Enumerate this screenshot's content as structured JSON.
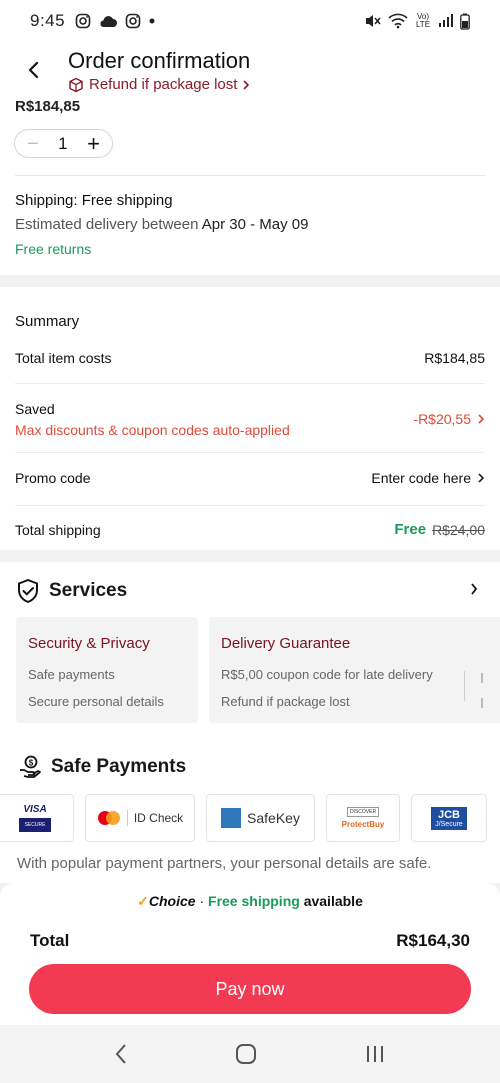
{
  "status_bar": {
    "time": "9:45",
    "network": "Vo) LTE"
  },
  "header": {
    "title": "Order confirmation",
    "refund_link": "Refund if package lost"
  },
  "product": {
    "price": "R$184,85",
    "quantity": "1",
    "minus": "−",
    "plus": "+"
  },
  "shipping": {
    "method_label": "Shipping: Free shipping",
    "estimate_prefix": "Estimated delivery between",
    "estimate_dates": "Apr 30 - May 09",
    "returns": "Free returns"
  },
  "summary": {
    "title": "Summary",
    "total_item_costs_label": "Total item costs",
    "total_item_costs_value": "R$184,85",
    "saved_label": "Saved",
    "saved_value": "-R$20,55",
    "saved_note": "Max discounts & coupon codes auto-applied",
    "promo_label": "Promo code",
    "promo_action": "Enter code here",
    "shipping_label": "Total shipping",
    "shipping_free": "Free",
    "shipping_original": "R$24,00"
  },
  "services": {
    "title": "Services",
    "cards": [
      {
        "title": "Security & Privacy",
        "items": [
          "Safe payments",
          "Secure personal details"
        ]
      },
      {
        "title": "Delivery Guarantee",
        "items": [
          "R$5,00 coupon code for late delivery",
          "Refund if package lost"
        ]
      }
    ]
  },
  "payments": {
    "title": "Safe Payments",
    "logos": [
      "VISA SECURE",
      "ID Check",
      "SafeKey",
      "ProtectBuy",
      "JCB J/Secure"
    ],
    "visa_text": "VISA",
    "visa_sub": "SECURE",
    "mc_text": "ID Check",
    "amex_text": "SafeKey",
    "discover_top": "DISCOVER",
    "discover_text": "ProtectBuy",
    "jcb_text": "JCB",
    "jcb_sub": "J/Secure",
    "note": "With popular payment partners, your personal details are safe."
  },
  "bottom": {
    "choice_brand": "Choice",
    "choice_sep": " · ",
    "choice_free": "Free shipping",
    "choice_tail": " available",
    "total_label": "Total",
    "total_value": "R$164,30",
    "pay_button": "Pay now"
  },
  "colors": {
    "accent": "#f23a52",
    "green": "#1a9b5b",
    "red": "#e24a37",
    "maroon": "#7a1222"
  }
}
